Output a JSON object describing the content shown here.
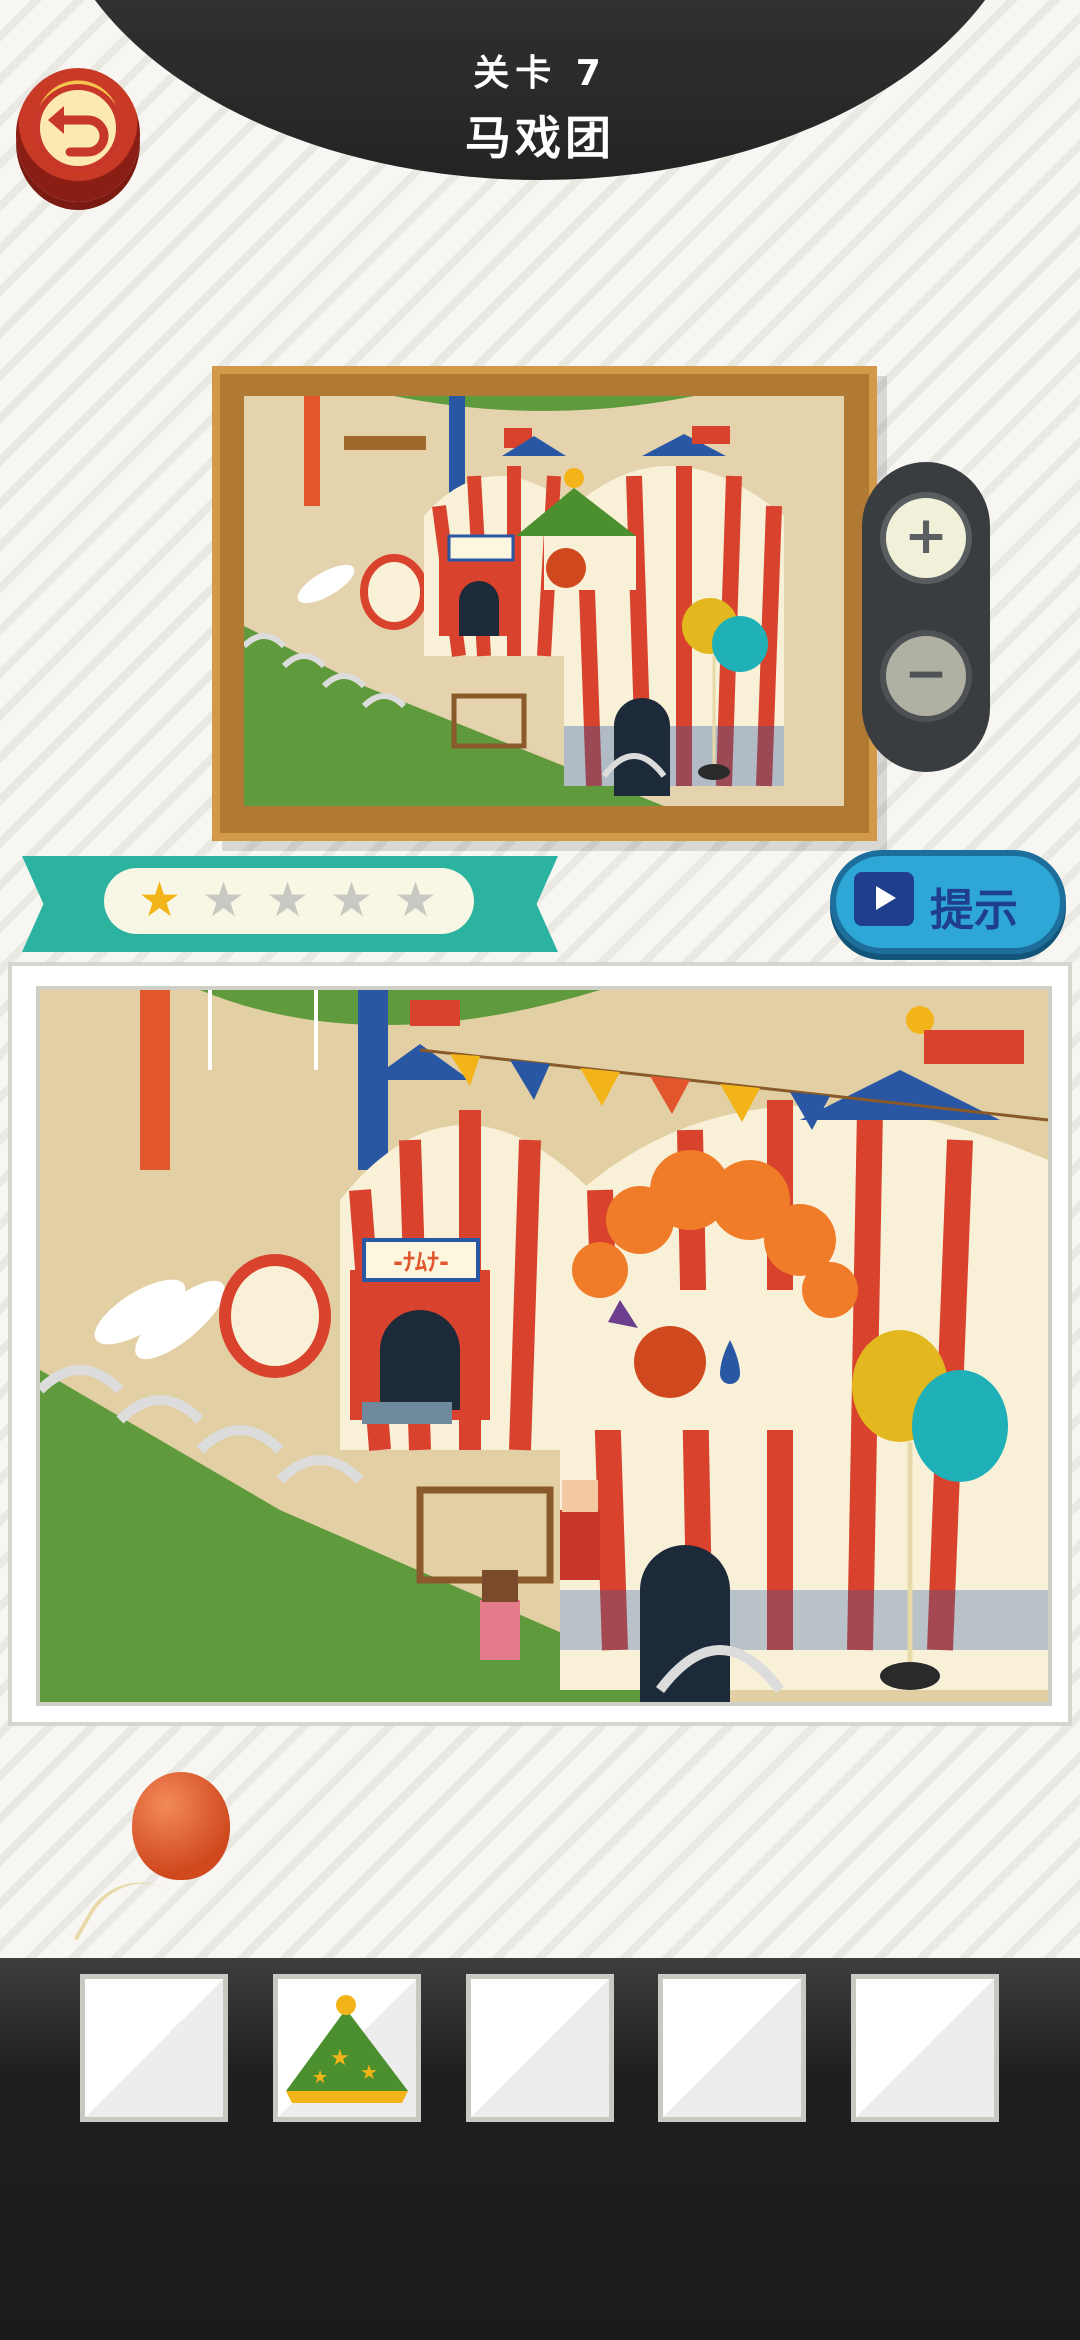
{
  "header": {
    "level_label": "关卡 7",
    "title": "马戏团"
  },
  "back_button": {
    "icon": "undo-arrow-icon"
  },
  "zoom": {
    "in_icon": "zoom-in-icon",
    "out_icon": "zoom-out-icon",
    "in_symbol": "+",
    "out_symbol": "−"
  },
  "rating": {
    "stars_total": 5,
    "stars_filled": 1,
    "star_glyph": "★",
    "filled_color": "#f3b419",
    "empty_color": "#c9c9c3"
  },
  "hint_button": {
    "label": "提示",
    "icon": "tv-play-icon"
  },
  "scene": {
    "ticket_sign": "-ﾅﾑﾅ-",
    "colors": {
      "tent_red": "#d9432d",
      "tent_cream": "#f8f1d8",
      "tent_blue": "#2a57a4",
      "grass": "#5f9a3c",
      "sand": "#e3cfa4"
    }
  },
  "found_item": {
    "name": "balloon",
    "color": "#d0481e"
  },
  "inventory": {
    "slots": [
      {
        "item": ""
      },
      {
        "item": "green-party-hat"
      },
      {
        "item": ""
      },
      {
        "item": ""
      },
      {
        "item": ""
      }
    ]
  }
}
